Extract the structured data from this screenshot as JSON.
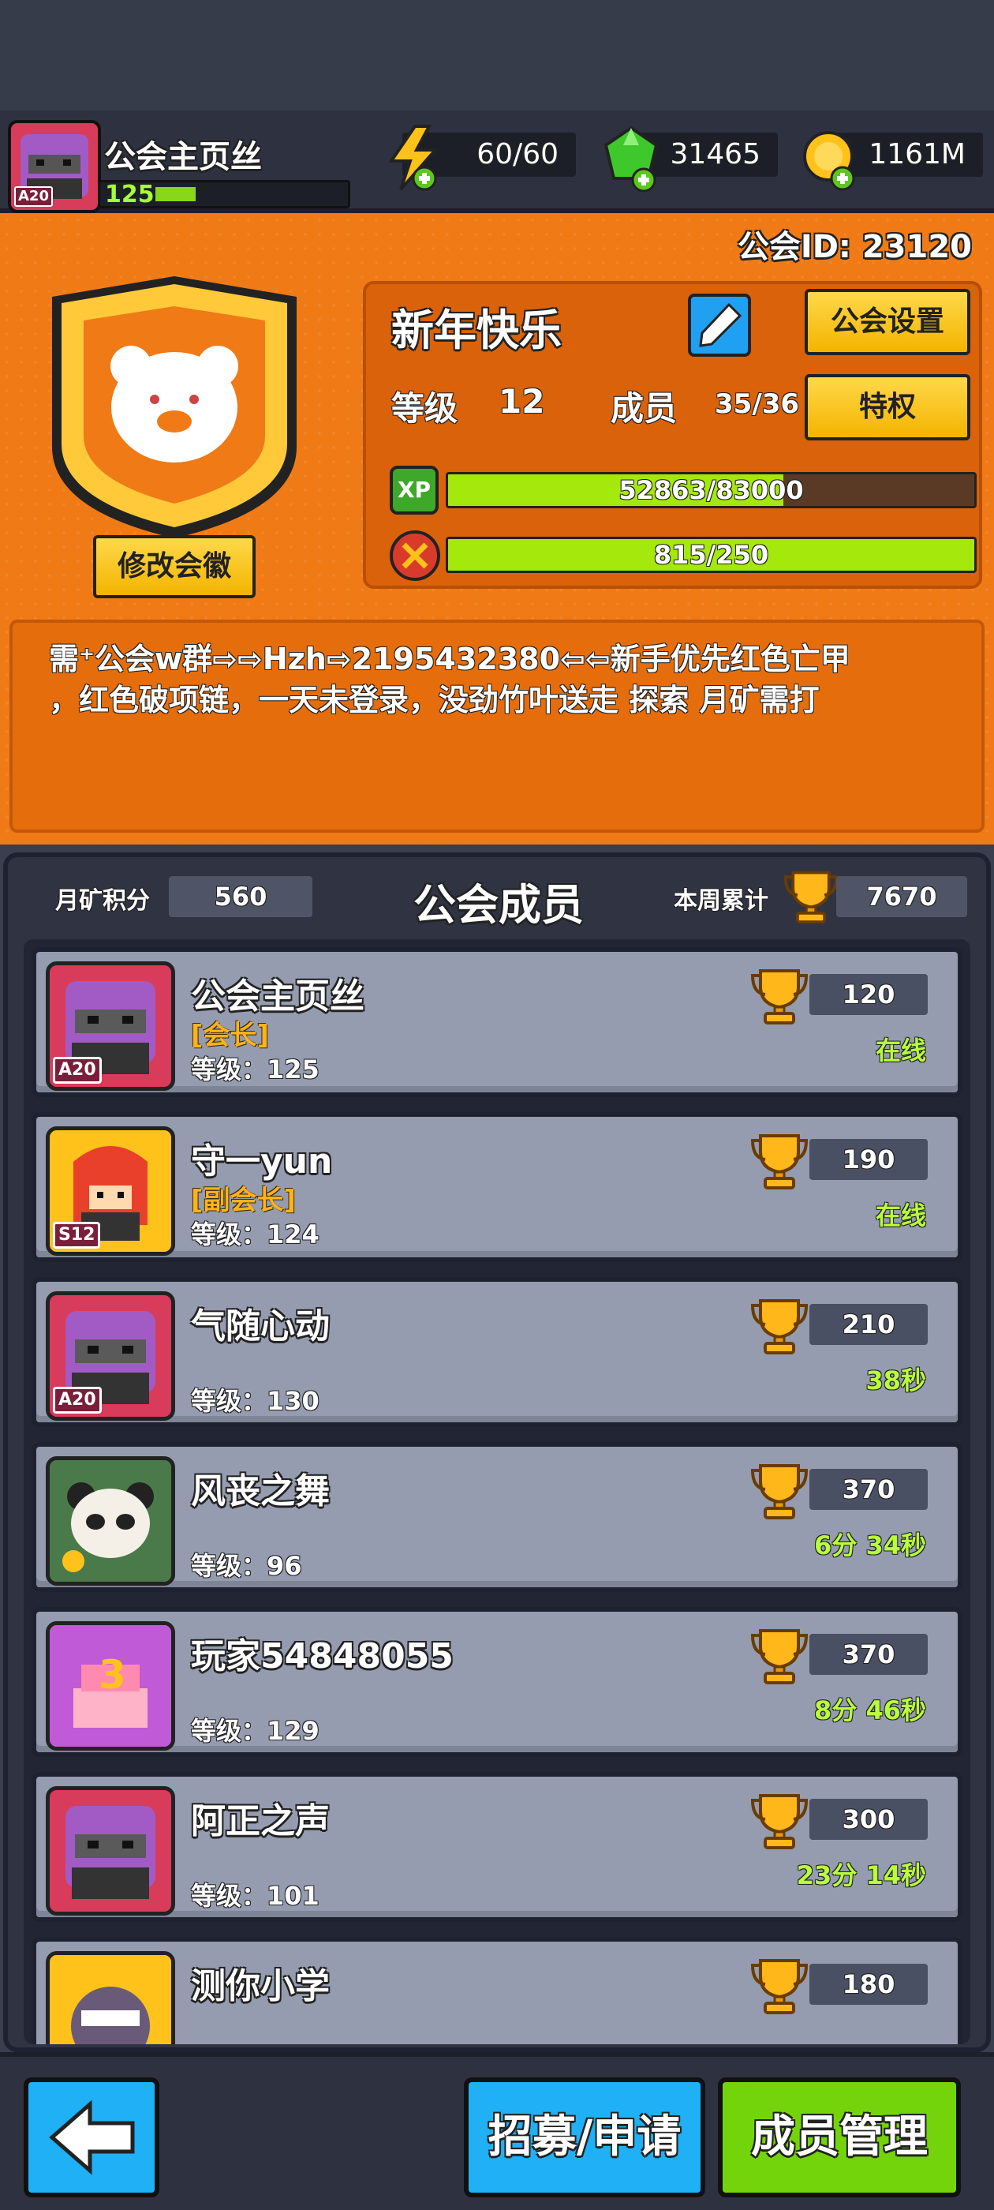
{
  "player": {
    "name": "公会主页丝",
    "level": "125",
    "avatar_tag": "A20",
    "xp_fraction": 0.3
  },
  "resources": {
    "energy": "60/60",
    "gems": "31465",
    "gold": "1161M"
  },
  "guild": {
    "id_label": "公会ID: 23120",
    "name": "新年快乐",
    "settings_label": "公会设置",
    "level_label": "等级",
    "level_value": "12",
    "members_label": "成员",
    "members_value": "35/36",
    "privilege_label": "特权",
    "xp_label": "XP",
    "xp_text": "52863/83000",
    "xp_fraction": 0.637,
    "activity_text": "815/250",
    "activity_fraction": 1.0,
    "change_emblem_label": "修改会徽",
    "notice_lines": [
      "需⁺公会w群⇨⇨Hzh⇨2195432380⇦⇦新手优先红色亡甲",
      "，红色破项链，一天未登录，没劲竹叶送走 探索 月矿需打"
    ]
  },
  "members_panel": {
    "title": "公会成员",
    "mine_label": "月矿积分",
    "mine_value": "560",
    "week_label": "本周累计",
    "week_value": "7670"
  },
  "members": [
    {
      "name": "公会主页丝",
      "role": "[会长]",
      "level": "等级：125",
      "score": "120",
      "status": "在线",
      "avatar_tag": "A20"
    },
    {
      "name": "守一yun",
      "role": "[副会长]",
      "level": "等级：124",
      "score": "190",
      "status": "在线",
      "avatar_tag": "S12"
    },
    {
      "name": "气随心动",
      "role": "",
      "level": "等级：130",
      "score": "210",
      "status": "38秒",
      "avatar_tag": "A20"
    },
    {
      "name": "风丧之舞",
      "role": "",
      "level": "等级：96",
      "score": "370",
      "status": "6分 34秒",
      "avatar_tag": ""
    },
    {
      "name": "玩家54848055",
      "role": "",
      "level": "等级：129",
      "score": "370",
      "status": "8分 46秒",
      "avatar_tag": ""
    },
    {
      "name": "阿正之声",
      "role": "",
      "level": "等级：101",
      "score": "300",
      "status": "23分 14秒",
      "avatar_tag": ""
    },
    {
      "name": "测你小学",
      "role": "",
      "level": "",
      "score": "180",
      "status": "",
      "avatar_tag": ""
    }
  ],
  "bottom": {
    "recruit_label": "招募/申请",
    "manage_label": "成员管理"
  },
  "colors": {
    "accent_orange": "#ef7a16",
    "online_green": "#b8ff3a",
    "button_yellow": "#ffc61a",
    "button_blue": "#1fb0f5",
    "button_green": "#74d40c"
  }
}
